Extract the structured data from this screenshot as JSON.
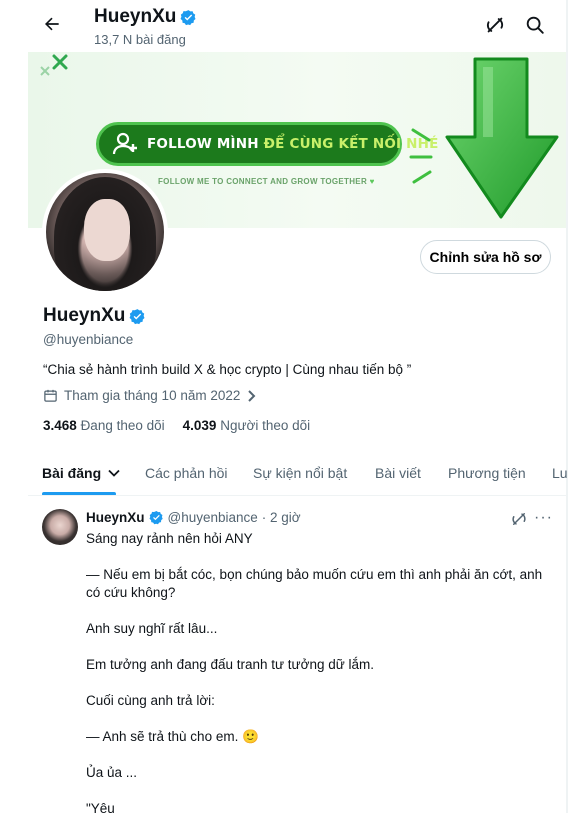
{
  "header": {
    "title": "HueynXu",
    "subtitle": "13,7 N bài đăng",
    "back_icon": "arrow-left-icon",
    "grok_icon": "grok-icon",
    "search_icon": "search-icon"
  },
  "banner": {
    "headline_part1": "FOLLOW MÌNH ",
    "headline_part2": "ĐỂ CÙNG KẾT NỐI NHÉ",
    "subline": "FOLLOW ME TO CONNECT AND GROW TOGETHER",
    "accent_color": "#1c7a1c",
    "arrow_color": "#3fbf3f"
  },
  "profile": {
    "display_name": "HueynXu",
    "handle": "@huyenbiance",
    "bio": "“Chia sẻ hành trình build X & học crypto | Cùng nhau tiến bộ ”",
    "joined": "Tham gia tháng 10 năm 2022",
    "following_count": "3.468",
    "following_label": "Đang theo dõi",
    "followers_count": "4.039",
    "followers_label": "Người theo dõi",
    "edit_button": "Chỉnh sửa hồ sơ",
    "verified_color": "#1d9bf0"
  },
  "tabs": [
    {
      "label": "Bài đăng"
    },
    {
      "label": "Các phản hồi"
    },
    {
      "label": "Sự kiện nổi bật"
    },
    {
      "label": "Bài viết"
    },
    {
      "label": "Phương tiện"
    },
    {
      "label": "Lu"
    }
  ],
  "post": {
    "author": "HueynXu",
    "handle": "@huyenbiance",
    "time": "· 2 giờ",
    "lines": [
      "Sáng nay rảnh nên hỏi ANY",
      "",
      "— Nếu em bị bắt cóc, bọn chúng bảo muốn cứu em thì anh phải ăn cớt, anh có cứu không?",
      "",
      "Anh suy nghĩ rất lâu...",
      "",
      "Em tưởng anh đang đấu tranh tư tưởng dữ lắm.",
      "",
      "Cuối cùng anh trả lời:",
      "",
      "— Anh sẽ trả thù cho em. 🙂",
      "",
      "Ủa ủa ...",
      "",
      "\"Yêu"
    ]
  }
}
